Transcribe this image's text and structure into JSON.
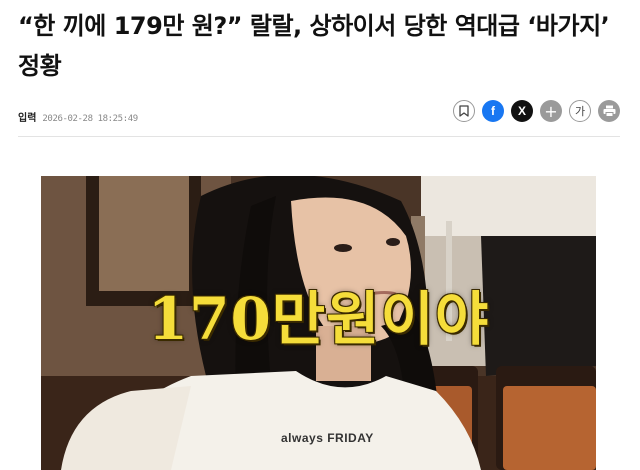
{
  "article": {
    "headline": "“한 끼에 179만 원?” 랄랄, 상하이서 당한 역대급 ‘바가지’ 정황",
    "meta_label": "입력",
    "published": "2026-02-28 18:25:49"
  },
  "share_bar": {
    "bookmark_icon": "bookmark-icon",
    "facebook_label": "f",
    "x_label": "X",
    "more_label": "+",
    "font_size_label": "가",
    "print_icon": "print-icon",
    "colors": {
      "facebook": "#1877f2",
      "x": "#111111",
      "more": "#9a9a9a"
    }
  },
  "photo": {
    "caption": "170만원이야",
    "shirt_text": "always FRIDAY",
    "caption_color": "#f5dd3a"
  }
}
